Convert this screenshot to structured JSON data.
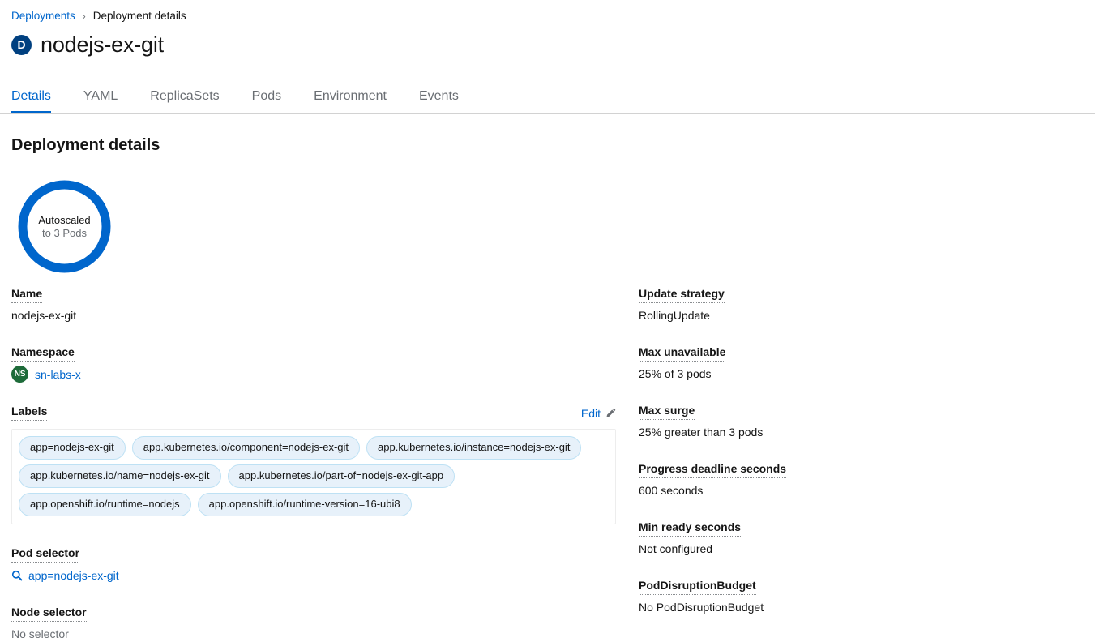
{
  "breadcrumb": {
    "parent": "Deployments",
    "separator": "›",
    "current": "Deployment details"
  },
  "header": {
    "badge_letter": "D",
    "title": "nodejs-ex-git",
    "badge_color": "#004080"
  },
  "tabs": [
    {
      "label": "Details",
      "active": true
    },
    {
      "label": "YAML",
      "active": false
    },
    {
      "label": "ReplicaSets",
      "active": false
    },
    {
      "label": "Pods",
      "active": false
    },
    {
      "label": "Environment",
      "active": false
    },
    {
      "label": "Events",
      "active": false
    }
  ],
  "section": {
    "title": "Deployment details"
  },
  "donut": {
    "line1": "Autoscaled",
    "line2": "to 3 Pods",
    "ring_color": "#0066cc",
    "pods": 3
  },
  "left_column": {
    "name": {
      "label": "Name",
      "value": "nodejs-ex-git"
    },
    "namespace": {
      "label": "Namespace",
      "badge_letters": "NS",
      "badge_color": "#1e6b3a",
      "value": "sn-labs-x"
    },
    "labels": {
      "label": "Labels",
      "edit_label": "Edit",
      "edit_icon": "pencil-icon",
      "chips": [
        "app=nodejs-ex-git",
        "app.kubernetes.io/component=nodejs-ex-git",
        "app.kubernetes.io/instance=nodejs-ex-git",
        "app.kubernetes.io/name=nodejs-ex-git",
        "app.kubernetes.io/part-of=nodejs-ex-git-app",
        "app.openshift.io/runtime=nodejs",
        "app.openshift.io/runtime-version=16-ubi8"
      ]
    },
    "pod_selector": {
      "label": "Pod selector",
      "icon": "search-icon",
      "value": "app=nodejs-ex-git"
    },
    "node_selector": {
      "label": "Node selector",
      "value": "No selector"
    }
  },
  "right_column": {
    "update_strategy": {
      "label": "Update strategy",
      "value": "RollingUpdate"
    },
    "max_unavailable": {
      "label": "Max unavailable",
      "value": "25% of 3 pods"
    },
    "max_surge": {
      "label": "Max surge",
      "value": "25% greater than 3 pods"
    },
    "progress_deadline_seconds": {
      "label": "Progress deadline seconds",
      "value": "600 seconds"
    },
    "min_ready_seconds": {
      "label": "Min ready seconds",
      "value": "Not configured"
    },
    "pod_disruption_budget": {
      "label": "PodDisruptionBudget",
      "value": "No PodDisruptionBudget"
    }
  }
}
